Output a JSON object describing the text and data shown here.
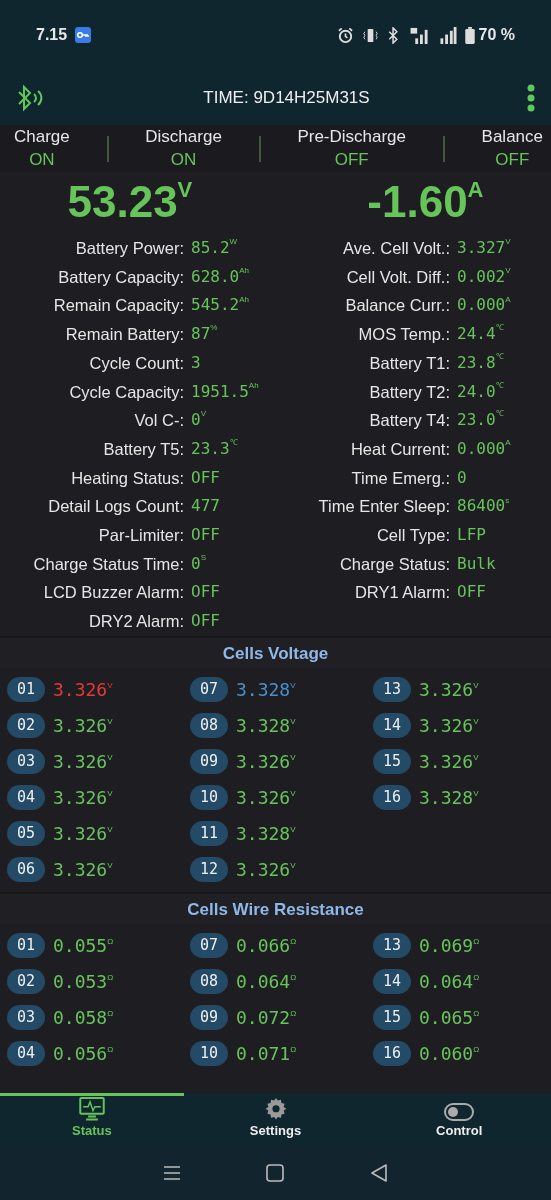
{
  "status_bar": {
    "time": "7.15",
    "battery": "70 %"
  },
  "app_bar": {
    "title": "TIME: 9D14H25M31S"
  },
  "switches": [
    {
      "label": "Charge",
      "state": "ON"
    },
    {
      "label": "Discharge",
      "state": "ON"
    },
    {
      "label": "Pre-Discharge",
      "state": "OFF"
    },
    {
      "label": "Balance",
      "state": "OFF"
    }
  ],
  "readings": [
    {
      "value": "53.23",
      "unit": "V"
    },
    {
      "value": "-1.60",
      "unit": "A"
    }
  ],
  "stats": {
    "left": [
      {
        "label": "Battery Power:",
        "value": "85.2",
        "unit": "W"
      },
      {
        "label": "Battery Capacity:",
        "value": "628.0",
        "unit": "Ah"
      },
      {
        "label": "Remain Capacity:",
        "value": "545.2",
        "unit": "Ah"
      },
      {
        "label": "Remain Battery:",
        "value": "87",
        "unit": "%"
      },
      {
        "label": "Cycle Count:",
        "value": "3"
      },
      {
        "label": "Cycle Capacity:",
        "value": "1951.5",
        "unit": "Ah"
      },
      {
        "label": "Vol C-:",
        "value": "0",
        "unit": "V"
      },
      {
        "label": "Battery T5:",
        "value": "23.3",
        "unit": "℃"
      },
      {
        "label": "Heating Status:",
        "value": "OFF"
      },
      {
        "label": "Detail Logs Count:",
        "value": "477"
      },
      {
        "label": "Par-Limiter:",
        "value": "OFF"
      },
      {
        "label": "Charge Status Time:",
        "value": "0",
        "unit": "S"
      },
      {
        "label": "LCD Buzzer Alarm:",
        "value": "OFF"
      },
      {
        "label": "DRY2 Alarm:",
        "value": "OFF"
      }
    ],
    "right": [
      {
        "label": "Ave. Cell Volt.:",
        "value": "3.327",
        "unit": "V"
      },
      {
        "label": "Cell Volt. Diff.:",
        "value": "0.002",
        "unit": "V"
      },
      {
        "label": "Balance Curr.:",
        "value": "0.000",
        "unit": "A"
      },
      {
        "label": "MOS Temp.:",
        "value": "24.4",
        "unit": "℃"
      },
      {
        "label": "Battery T1:",
        "value": "23.8",
        "unit": "℃"
      },
      {
        "label": "Battery T2:",
        "value": "24.0",
        "unit": "℃"
      },
      {
        "label": "Battery T4:",
        "value": "23.0",
        "unit": "℃"
      },
      {
        "label": "Heat Current:",
        "value": "0.000",
        "unit": "A"
      },
      {
        "label": "Time Emerg.:",
        "value": "0"
      },
      {
        "label": "Time Enter Sleep:",
        "value": "86400",
        "unit": "s"
      },
      {
        "label": "Cell Type:",
        "value": "LFP"
      },
      {
        "label": "Charge Status:",
        "value": "Bulk"
      },
      {
        "label": "DRY1 Alarm:",
        "value": "OFF"
      }
    ]
  },
  "cells_voltage": {
    "title": "Cells Voltage",
    "columns": [
      [
        {
          "number": "01",
          "value": "3.326",
          "unit": "V",
          "color": "#e53935"
        },
        {
          "number": "02",
          "value": "3.326",
          "unit": "V",
          "color": "#66c45a"
        },
        {
          "number": "03",
          "value": "3.326",
          "unit": "V",
          "color": "#66c45a"
        },
        {
          "number": "04",
          "value": "3.326",
          "unit": "V",
          "color": "#66c45a"
        },
        {
          "number": "05",
          "value": "3.326",
          "unit": "V",
          "color": "#66c45a"
        },
        {
          "number": "06",
          "value": "3.326",
          "unit": "V",
          "color": "#66c45a"
        }
      ],
      [
        {
          "number": "07",
          "value": "3.328",
          "unit": "V",
          "color": "#4a90d0"
        },
        {
          "number": "08",
          "value": "3.328",
          "unit": "V",
          "color": "#66c45a"
        },
        {
          "number": "09",
          "value": "3.326",
          "unit": "V",
          "color": "#66c45a"
        },
        {
          "number": "10",
          "value": "3.326",
          "unit": "V",
          "color": "#66c45a"
        },
        {
          "number": "11",
          "value": "3.328",
          "unit": "V",
          "color": "#66c45a"
        },
        {
          "number": "12",
          "value": "3.326",
          "unit": "V",
          "color": "#66c45a"
        }
      ],
      [
        {
          "number": "13",
          "value": "3.326",
          "unit": "V",
          "color": "#66c45a"
        },
        {
          "number": "14",
          "value": "3.326",
          "unit": "V",
          "color": "#66c45a"
        },
        {
          "number": "15",
          "value": "3.326",
          "unit": "V",
          "color": "#66c45a"
        },
        {
          "number": "16",
          "value": "3.328",
          "unit": "V",
          "color": "#66c45a"
        }
      ]
    ]
  },
  "cells_wire_resistance": {
    "title": "Cells Wire Resistance",
    "columns": [
      [
        {
          "number": "01",
          "value": "0.055",
          "unit": "Ω"
        },
        {
          "number": "02",
          "value": "0.053",
          "unit": "Ω"
        },
        {
          "number": "03",
          "value": "0.058",
          "unit": "Ω"
        },
        {
          "number": "04",
          "value": "0.056",
          "unit": "Ω"
        }
      ],
      [
        {
          "number": "07",
          "value": "0.066",
          "unit": "Ω"
        },
        {
          "number": "08",
          "value": "0.064",
          "unit": "Ω"
        },
        {
          "number": "09",
          "value": "0.072",
          "unit": "Ω"
        },
        {
          "number": "10",
          "value": "0.071",
          "unit": "Ω"
        }
      ],
      [
        {
          "number": "13",
          "value": "0.069",
          "unit": "Ω"
        },
        {
          "number": "14",
          "value": "0.064",
          "unit": "Ω"
        },
        {
          "number": "15",
          "value": "0.065",
          "unit": "Ω"
        },
        {
          "number": "16",
          "value": "0.060",
          "unit": "Ω"
        }
      ]
    ]
  },
  "bottom_nav": [
    {
      "label": "Status",
      "kind": "status",
      "selected": true
    },
    {
      "label": "Settings",
      "kind": "settings",
      "selected": false
    },
    {
      "label": "Control",
      "kind": "control",
      "selected": false
    }
  ]
}
